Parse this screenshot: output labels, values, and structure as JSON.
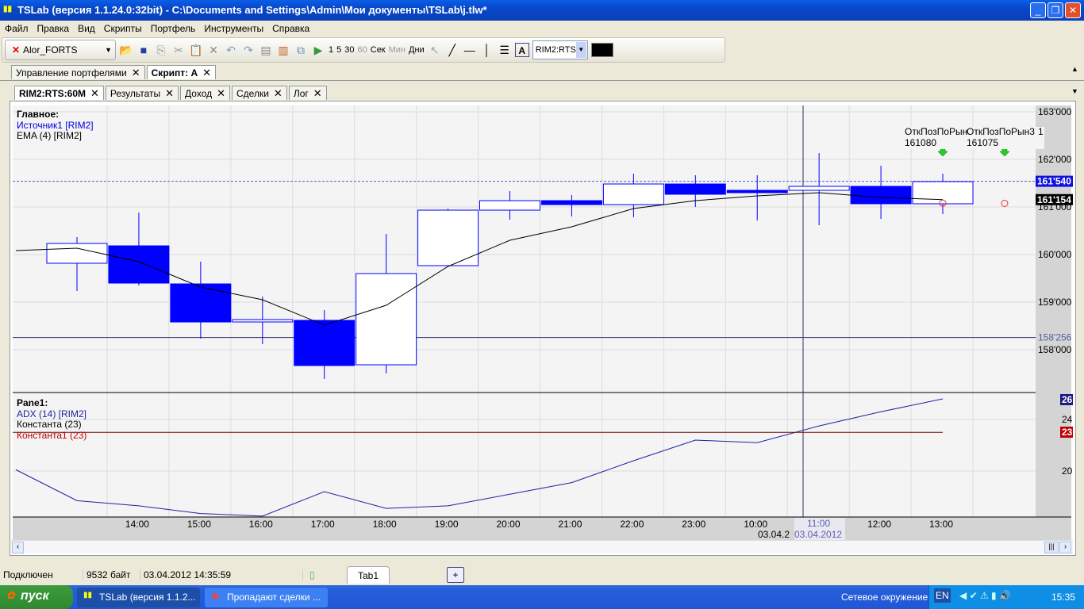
{
  "window": {
    "title": "TSLab (версия 1.1.24.0:32bit) - C:\\Documents and Settings\\Admin\\Мои документы\\TSLab\\j.tlw*"
  },
  "menu": [
    "Файл",
    "Правка",
    "Вид",
    "Скрипты",
    "Портфель",
    "Инструменты",
    "Справка"
  ],
  "toolbar": {
    "connection": "Alor_FORTS",
    "intervals": [
      "1",
      "5",
      "30",
      "60"
    ],
    "units": [
      "Сек",
      "Мин",
      "Дни"
    ],
    "symbol": "RIM2:RTS"
  },
  "doc_tabs": [
    {
      "label": "Управление портфелями"
    },
    {
      "label": "Скрипт: A"
    }
  ],
  "chart_tabs": [
    {
      "label": "RIM2:RTS:60M"
    },
    {
      "label": "Результаты"
    },
    {
      "label": "Доход"
    },
    {
      "label": "Сделки"
    },
    {
      "label": "Лог"
    }
  ],
  "chart_data": [
    {
      "type": "candlestick",
      "pane": "Главное:",
      "legend": [
        "Источник1 [RIM2]",
        "EMA (4) [RIM2]"
      ],
      "x": [
        "13:00",
        "14:00",
        "15:00",
        "16:00",
        "17:00",
        "18:00",
        "19:00",
        "20:00",
        "21:00",
        "22:00",
        "23:00",
        "10:00",
        "11:00",
        "12:00",
        "13:00"
      ],
      "ohlc": [
        [
          159817,
          160367,
          159233,
          160233
        ],
        [
          160183,
          160883,
          159350,
          159400
        ],
        [
          159383,
          159850,
          158233,
          158583
        ],
        [
          158583,
          159117,
          158117,
          158633
        ],
        [
          158617,
          158833,
          157383,
          157667
        ],
        [
          157683,
          160433,
          157500,
          159600
        ],
        [
          159767,
          160967,
          159750,
          160933
        ],
        [
          160933,
          161333,
          160733,
          161133
        ],
        [
          161133,
          161250,
          160800,
          161050
        ],
        [
          161050,
          161700,
          160783,
          161483
        ],
        [
          161483,
          161667,
          161000,
          161267
        ],
        [
          161350,
          161667,
          160717,
          161300
        ],
        [
          161350,
          162133,
          160617,
          161433
        ],
        [
          161433,
          161867,
          160750,
          161067
        ],
        [
          161067,
          161700,
          160850,
          161533
        ]
      ],
      "ema": [
        160133,
        159850,
        159317,
        159050,
        158517,
        158933,
        159750,
        160300,
        160583,
        160967,
        161133,
        161233,
        161300,
        161200,
        161154
      ],
      "ema_start": 160083,
      "yticks": [
        "163'000",
        "162'000",
        "161'000",
        "160'000",
        "159'000",
        "158'000"
      ],
      "ytick_values": [
        163000,
        162000,
        161000,
        160000,
        159000,
        158000
      ],
      "last_price_label": "161'540",
      "ema_label": "161'154",
      "cursor_label": "158'256",
      "last_price": 161540,
      "cursor_price": 158256,
      "signals": [
        {
          "name": "ОткПозПоРын",
          "price": "161080"
        },
        {
          "name": "ОткПозПоРын3",
          "price": "161075"
        }
      ],
      "signal_extra": "1"
    },
    {
      "type": "line",
      "pane": "Pane1:",
      "legend": [
        "ADX (14) [RIM2]",
        "Константа (23)",
        "Константа1 (23)"
      ],
      "adx": [
        17.7,
        17.3,
        16.7,
        16.5,
        18.4,
        17.1,
        17.3,
        18.2,
        19.1,
        20.8,
        22.4,
        22.2,
        23.5,
        24.6,
        25.6
      ],
      "adx_start": 20.1,
      "constant": 23,
      "yticks": [
        "24",
        "20"
      ],
      "ytick_values": [
        24,
        20
      ],
      "adx_label": "26",
      "const_label": "23"
    }
  ],
  "xaxis": {
    "labels": [
      "14:00",
      "15:00",
      "16:00",
      "17:00",
      "18:00",
      "19:00",
      "20:00",
      "21:00",
      "22:00",
      "23:00",
      "10:00",
      "11:00",
      "12:00",
      "13:00"
    ],
    "date": "03.04.2012",
    "cursor_time": "11:00",
    "cursor_date": "03.04.2012",
    "date_partial": "03.04.2"
  },
  "status": {
    "connection": "Подключен",
    "bytes": "9532 байт",
    "datetime": "03.04.2012 14:35:59",
    "tab": "Tab1",
    "add": "+"
  },
  "taskbar": {
    "start": "пуск",
    "tasks": [
      "TSLab (версия 1.1.2...",
      "Пропадают сделки ..."
    ],
    "network": "Сетевое окружение",
    "lang": "EN",
    "clock": "15:35"
  }
}
